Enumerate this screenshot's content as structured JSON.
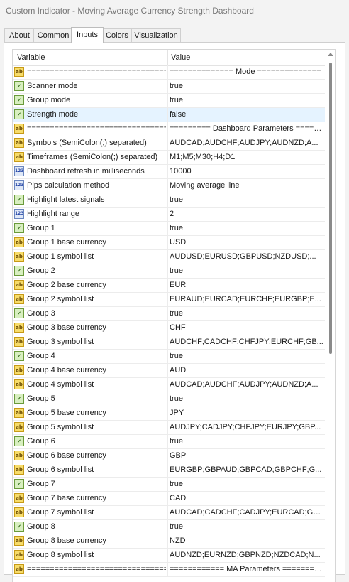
{
  "window": {
    "title": "Custom Indicator - Moving Average Currency Strength Dashboard"
  },
  "tabs": [
    {
      "label": "About"
    },
    {
      "label": "Common"
    },
    {
      "label": "Inputs",
      "active": true
    },
    {
      "label": "Colors"
    },
    {
      "label": "Visualization"
    }
  ],
  "table": {
    "header": {
      "variable": "Variable",
      "value": "Value"
    },
    "rows": [
      {
        "type": "ab",
        "icon": "string-icon",
        "variable": "================================",
        "value": "============== Mode =============="
      },
      {
        "type": "bool",
        "icon": "boolean-icon",
        "variable": "Scanner mode",
        "value": "true"
      },
      {
        "type": "bool",
        "icon": "boolean-icon",
        "variable": "Group mode",
        "value": "true"
      },
      {
        "type": "bool",
        "icon": "boolean-icon",
        "variable": "Strength mode",
        "value": "false",
        "selected": true
      },
      {
        "type": "ab",
        "icon": "string-icon",
        "variable": "================================",
        "value": "========= Dashboard Parameters =====..."
      },
      {
        "type": "ab",
        "icon": "string-icon",
        "variable": "Symbols (SemiColon(;) separated)",
        "value": "AUDCAD;AUDCHF;AUDJPY;AUDNZD;A..."
      },
      {
        "type": "ab",
        "icon": "string-icon",
        "variable": "Timeframes (SemiColon(;) separated)",
        "value": "M1;M5;M30;H4;D1"
      },
      {
        "type": "num",
        "icon": "number-icon",
        "variable": "Dashboard refresh in milliseconds",
        "value": "10000"
      },
      {
        "type": "num",
        "icon": "number-icon",
        "variable": "Pips calculation method",
        "value": "Moving average line"
      },
      {
        "type": "bool",
        "icon": "boolean-icon",
        "variable": "Highlight latest signals",
        "value": "true"
      },
      {
        "type": "num",
        "icon": "number-icon",
        "variable": "Highlight range",
        "value": "2"
      },
      {
        "type": "bool",
        "icon": "boolean-icon",
        "variable": "Group 1",
        "value": "true"
      },
      {
        "type": "ab",
        "icon": "string-icon",
        "variable": "Group 1 base currency",
        "value": "USD"
      },
      {
        "type": "ab",
        "icon": "string-icon",
        "variable": "Group 1 symbol list",
        "value": "AUDUSD;EURUSD;GBPUSD;NZDUSD;..."
      },
      {
        "type": "bool",
        "icon": "boolean-icon",
        "variable": "Group 2",
        "value": "true"
      },
      {
        "type": "ab",
        "icon": "string-icon",
        "variable": "Group 2 base currency",
        "value": "EUR"
      },
      {
        "type": "ab",
        "icon": "string-icon",
        "variable": "Group 2 symbol list",
        "value": "EURAUD;EURCAD;EURCHF;EURGBP;E..."
      },
      {
        "type": "bool",
        "icon": "boolean-icon",
        "variable": "Group 3",
        "value": "true"
      },
      {
        "type": "ab",
        "icon": "string-icon",
        "variable": "Group 3 base currency",
        "value": "CHF"
      },
      {
        "type": "ab",
        "icon": "string-icon",
        "variable": "Group 3 symbol list",
        "value": "AUDCHF;CADCHF;CHFJPY;EURCHF;GB..."
      },
      {
        "type": "bool",
        "icon": "boolean-icon",
        "variable": "Group 4",
        "value": "true"
      },
      {
        "type": "ab",
        "icon": "string-icon",
        "variable": "Group 4 base currency",
        "value": "AUD"
      },
      {
        "type": "ab",
        "icon": "string-icon",
        "variable": "Group 4 symbol list",
        "value": "AUDCAD;AUDCHF;AUDJPY;AUDNZD;A..."
      },
      {
        "type": "bool",
        "icon": "boolean-icon",
        "variable": "Group 5",
        "value": "true"
      },
      {
        "type": "ab",
        "icon": "string-icon",
        "variable": "Group 5 base currency",
        "value": "JPY"
      },
      {
        "type": "ab",
        "icon": "string-icon",
        "variable": "Group 5 symbol list",
        "value": "AUDJPY;CADJPY;CHFJPY;EURJPY;GBP..."
      },
      {
        "type": "bool",
        "icon": "boolean-icon",
        "variable": "Group 6",
        "value": "true"
      },
      {
        "type": "ab",
        "icon": "string-icon",
        "variable": "Group 6 base currency",
        "value": "GBP"
      },
      {
        "type": "ab",
        "icon": "string-icon",
        "variable": "Group 6 symbol list",
        "value": "EURGBP;GBPAUD;GBPCAD;GBPCHF;G..."
      },
      {
        "type": "bool",
        "icon": "boolean-icon",
        "variable": "Group 7",
        "value": "true"
      },
      {
        "type": "ab",
        "icon": "string-icon",
        "variable": "Group 7 base currency",
        "value": "CAD"
      },
      {
        "type": "ab",
        "icon": "string-icon",
        "variable": "Group 7 symbol list",
        "value": "AUDCAD;CADCHF;CADJPY;EURCAD;GB..."
      },
      {
        "type": "bool",
        "icon": "boolean-icon",
        "variable": "Group 8",
        "value": "true"
      },
      {
        "type": "ab",
        "icon": "string-icon",
        "variable": "Group 8 base currency",
        "value": "NZD"
      },
      {
        "type": "ab",
        "icon": "string-icon",
        "variable": "Group 8 symbol list",
        "value": "AUDNZD;EURNZD;GBPNZD;NZDCAD;N..."
      },
      {
        "type": "ab",
        "icon": "string-icon",
        "variable": "================================",
        "value": "============ MA Parameters =========..."
      }
    ]
  },
  "icon_glyphs": {
    "ab": "ab",
    "bool": "✔",
    "num": "123"
  },
  "colors": {
    "selected_row": "#e5f3ff",
    "accent": "#0078d7"
  }
}
